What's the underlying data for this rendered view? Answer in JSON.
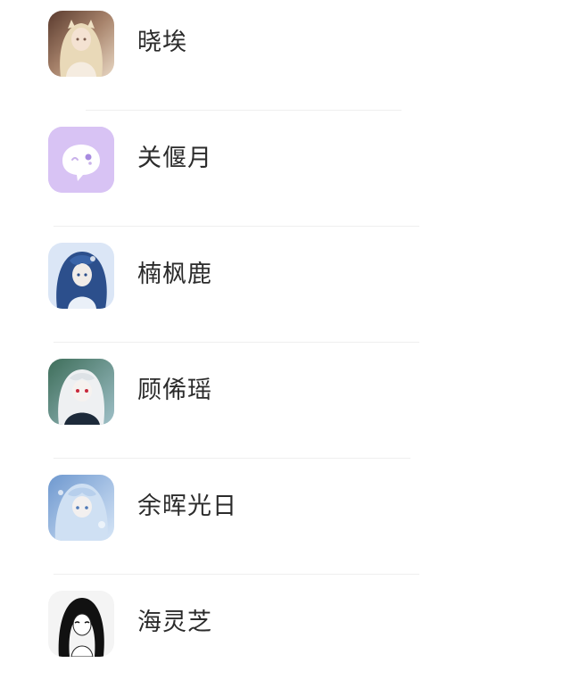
{
  "contacts": [
    {
      "name": "晓埃",
      "avatar_icon": "avatar-blonde-girl-icon"
    },
    {
      "name": "关偃月",
      "avatar_icon": "chat-bubble-icon"
    },
    {
      "name": "楠枫鹿",
      "avatar_icon": "avatar-blue-hair-girl-icon"
    },
    {
      "name": "顾俙瑶",
      "avatar_icon": "avatar-white-hair-red-eyes-icon"
    },
    {
      "name": "余晖光日",
      "avatar_icon": "avatar-light-blue-girl-icon"
    },
    {
      "name": "海灵芝",
      "avatar_icon": "avatar-black-hair-sketch-icon"
    }
  ],
  "colors": {
    "text": "#2b2b2b",
    "divider": "#eeeeee",
    "chat_avatar_bg": "#d8c3f4"
  }
}
